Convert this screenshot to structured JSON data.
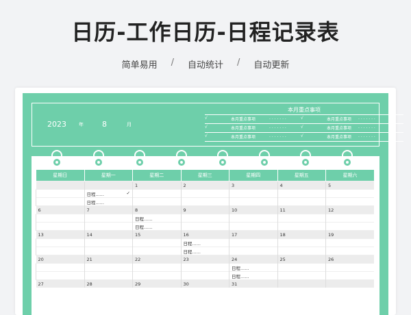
{
  "page": {
    "title": "日历-工作日历-日程记录表",
    "tags": [
      "简单易用",
      "自动统计",
      "自动更新"
    ],
    "separator": "/"
  },
  "header": {
    "year": "2023",
    "year_label": "年",
    "month": "8",
    "month_label": "月",
    "notes_title": "本月重点事项",
    "note_label": "本月重点事项",
    "note_dots": ". . . . . . .",
    "check": "√",
    "ring_count": 8
  },
  "calendar": {
    "weekdays": [
      "星期日",
      "星期一",
      "星期二",
      "星期三",
      "星期四",
      "星期五",
      "星期六"
    ],
    "weeks": [
      {
        "days": [
          "",
          "",
          "1",
          "2",
          "3",
          "4",
          "5"
        ],
        "rows": [
          [
            "",
            "日程......",
            "",
            "",
            "",
            "",
            ""
          ],
          [
            "",
            "日程......",
            "",
            "",
            "",
            "",
            ""
          ]
        ]
      },
      {
        "days": [
          "6",
          "7",
          "8",
          "9",
          "10",
          "11",
          "12"
        ],
        "rows": [
          [
            "",
            "",
            "日程......",
            "",
            "",
            "",
            ""
          ],
          [
            "",
            "",
            "日程......",
            "",
            "",
            "",
            ""
          ]
        ]
      },
      {
        "days": [
          "13",
          "14",
          "15",
          "16",
          "17",
          "18",
          "19"
        ],
        "rows": [
          [
            "",
            "",
            "",
            "日程......",
            "",
            "",
            ""
          ],
          [
            "",
            "",
            "",
            "日程......",
            "",
            "",
            ""
          ]
        ]
      },
      {
        "days": [
          "20",
          "21",
          "22",
          "23",
          "24",
          "25",
          "26"
        ],
        "rows": [
          [
            "",
            "",
            "",
            "",
            "日程......",
            "",
            ""
          ],
          [
            "",
            "",
            "",
            "",
            "日程......",
            "",
            ""
          ]
        ]
      },
      {
        "days": [
          "27",
          "28",
          "29",
          "30",
          "31",
          "",
          ""
        ],
        "rows": []
      }
    ],
    "first_row_check": "✓"
  },
  "colors": {
    "accent": "#6ecfaa"
  }
}
